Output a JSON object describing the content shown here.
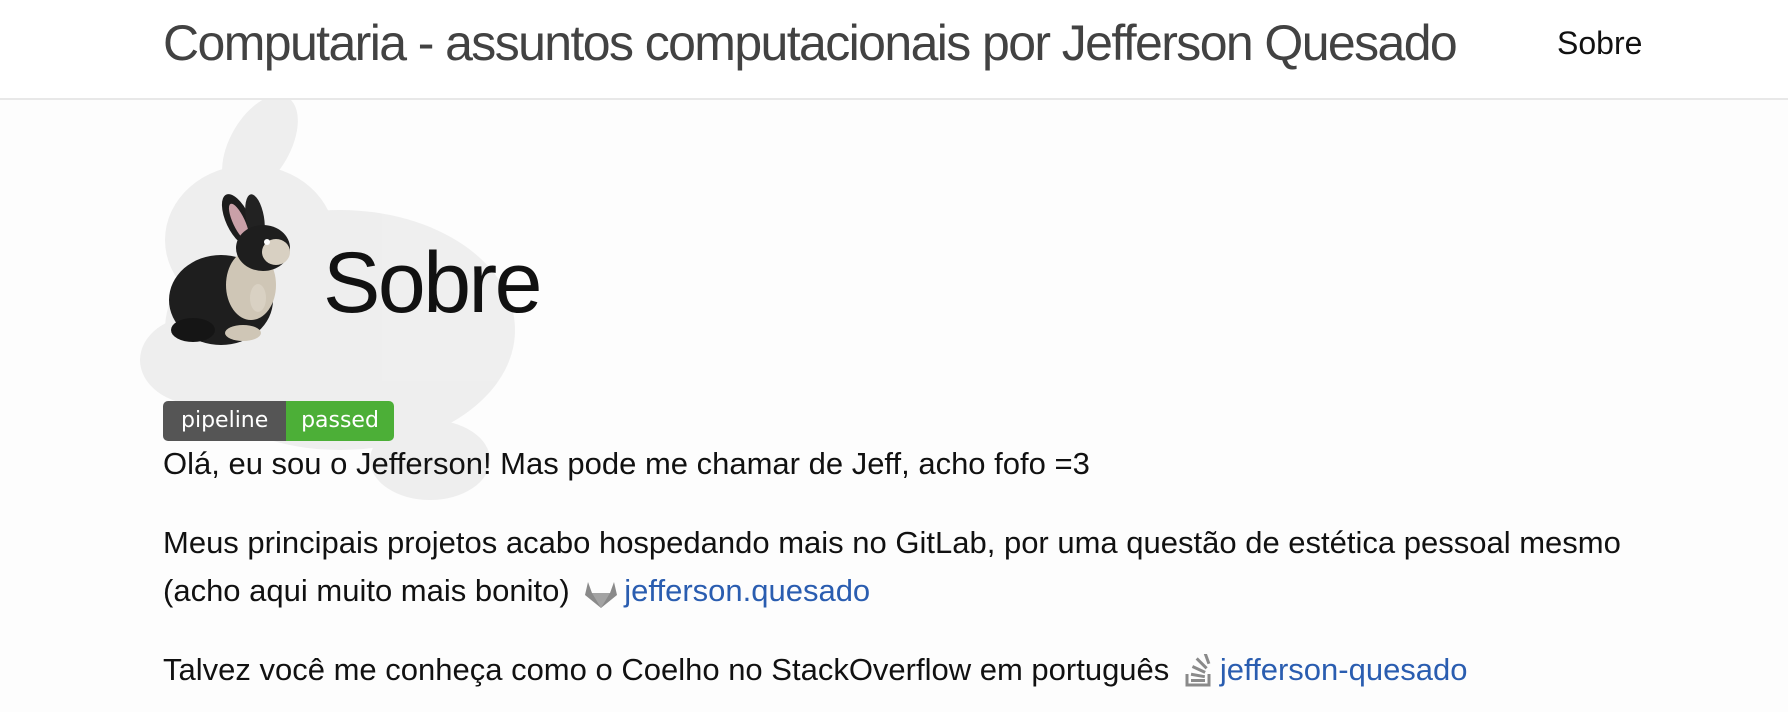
{
  "header": {
    "site_title": "Computaria - assuntos computacionais por Jefferson Quesado",
    "nav": [
      {
        "label": "Sobre"
      }
    ]
  },
  "page": {
    "title": "Sobre"
  },
  "badge": {
    "label": "pipeline",
    "status": "passed",
    "status_color": "#4caf37"
  },
  "content": {
    "paragraph1": "Olá, eu sou o Jefferson! Mas pode me chamar de Jeff, acho fofo =3",
    "paragraph2_text": "Meus principais projetos acabo hospedando mais no GitLab, por uma questão de estética pessoal mesmo (acho aqui muito mais bonito)",
    "paragraph2_icon": "gitlab-icon",
    "paragraph2_link": "jefferson.quesado",
    "paragraph3_text": "Talvez você me conheça como o Coelho no StackOverflow em português",
    "paragraph3_icon": "stackoverflow-icon",
    "paragraph3_link": "jefferson-quesado"
  },
  "colors": {
    "link": "#2a5db0",
    "header_border": "#e8e8e8"
  }
}
